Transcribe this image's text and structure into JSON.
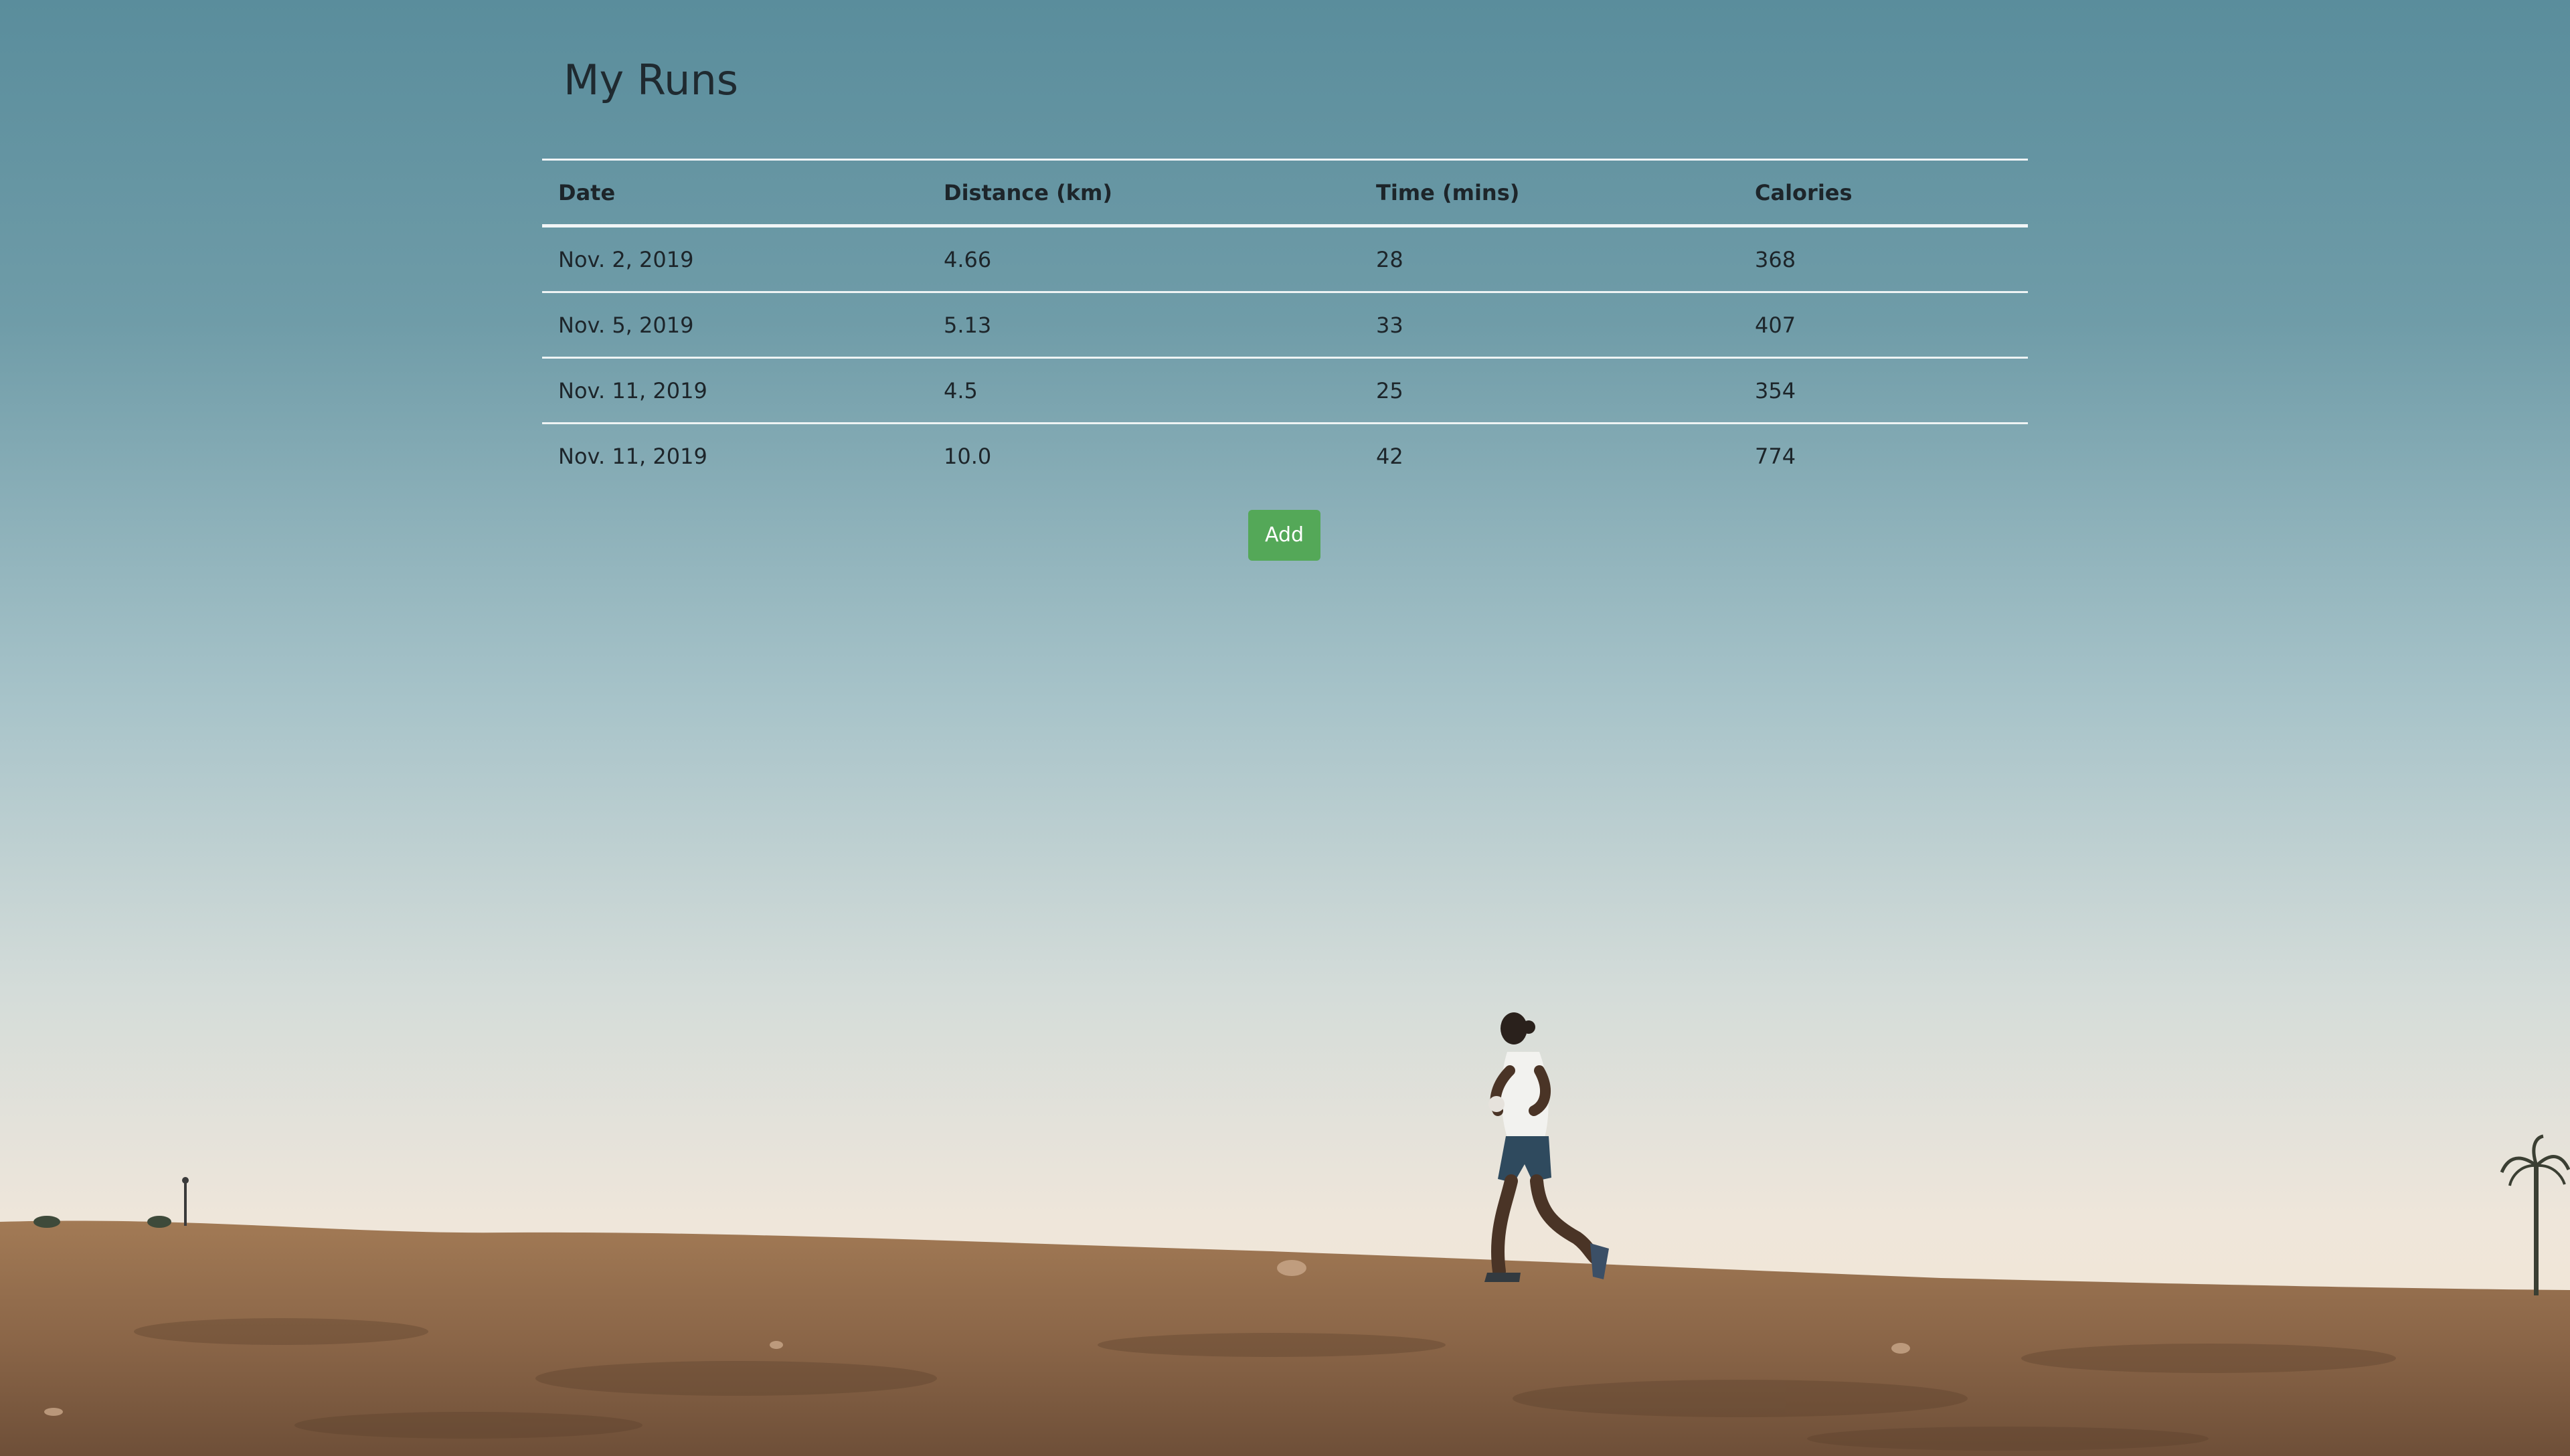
{
  "page": {
    "title": "My Runs"
  },
  "table": {
    "headers": {
      "date": "Date",
      "distance": "Distance (km)",
      "time": "Time (mins)",
      "calories": "Calories"
    },
    "rows": [
      {
        "date": "Nov. 2, 2019",
        "distance": "4.66",
        "time": "28",
        "calories": "368"
      },
      {
        "date": "Nov. 5, 2019",
        "distance": "5.13",
        "time": "33",
        "calories": "407"
      },
      {
        "date": "Nov. 11, 2019",
        "distance": "4.5",
        "time": "25",
        "calories": "354"
      },
      {
        "date": "Nov. 11, 2019",
        "distance": "10.0",
        "time": "42",
        "calories": "774"
      }
    ]
  },
  "actions": {
    "add_label": "Add"
  },
  "theme": {
    "sky_top": "#5a8d9c",
    "sky_mid": "#a7c3c9",
    "horizon": "#efe6da",
    "ground": "#8f6a4a",
    "add_button": "#54a858"
  }
}
